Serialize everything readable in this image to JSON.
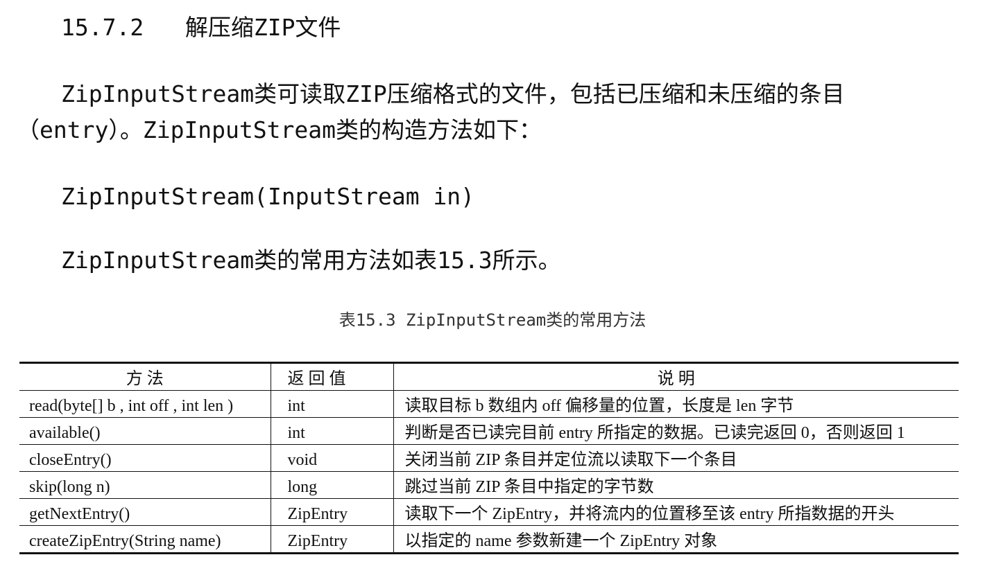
{
  "section_heading": {
    "number": "15.7.2",
    "title": "解压缩ZIP文件"
  },
  "intro_paragraph": "ZipInputStream类可读取ZIP压缩格式的文件，包括已压缩和未压缩的条目（entry）。ZipInputStream类的构造方法如下：",
  "constructor_signature": "ZipInputStream(InputStream in)",
  "methods_intro": "ZipInputStream类的常用方法如表15.3所示。",
  "table": {
    "caption": "表15.3   ZipInputStream类的常用方法",
    "headers": [
      "方      法",
      "返    回    值",
      "说          明"
    ],
    "rows": [
      {
        "method": "read(byte[] b , int off , int len )",
        "returns": "int",
        "description": "读取目标 b 数组内 off 偏移量的位置，长度是 len 字节"
      },
      {
        "method": "available()",
        "returns": "int",
        "description": "判断是否已读完目前 entry 所指定的数据。已读完返回 0，否则返回 1"
      },
      {
        "method": "closeEntry()",
        "returns": "void",
        "description": "关闭当前 ZIP 条目并定位流以读取下一个条目"
      },
      {
        "method": "skip(long n)",
        "returns": "long",
        "description": "跳过当前 ZIP 条目中指定的字节数"
      },
      {
        "method": "getNextEntry()",
        "returns": "ZipEntry",
        "description": "读取下一个 ZipEntry，并将流内的位置移至该 entry 所指数据的开头"
      },
      {
        "method": "createZipEntry(String name)",
        "returns": "ZipEntry",
        "description": "以指定的 name 参数新建一个 ZipEntry 对象"
      }
    ]
  }
}
